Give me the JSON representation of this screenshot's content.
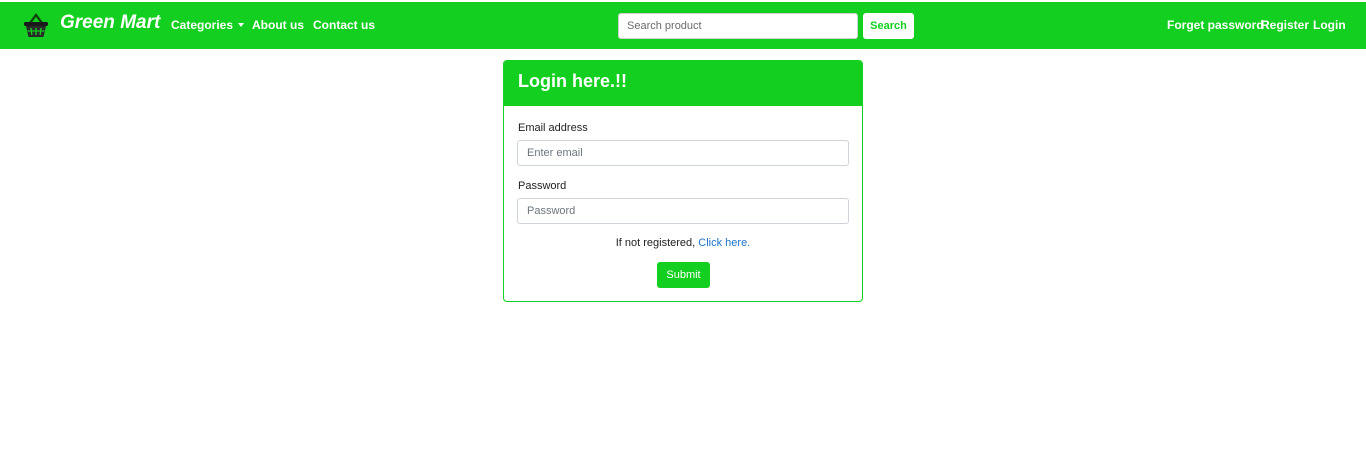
{
  "brand": {
    "name": "Green Mart",
    "icon": "basket-icon"
  },
  "nav": {
    "categories": "Categories",
    "about": "About us",
    "contact": "Contact us",
    "forget_password": "Forget password",
    "register": "Register",
    "login": "Login"
  },
  "search": {
    "placeholder": "Search product",
    "value": "",
    "button": "Search"
  },
  "login_card": {
    "title": "Login here.!!",
    "email_label": "Email address",
    "email_placeholder": "Enter email",
    "password_label": "Password",
    "password_placeholder": "Password",
    "register_prefix": "If not registered, ",
    "register_link": "Click here.",
    "submit": "Submit"
  },
  "colors": {
    "accent": "#13cf1f",
    "link": "#1a73c9"
  }
}
